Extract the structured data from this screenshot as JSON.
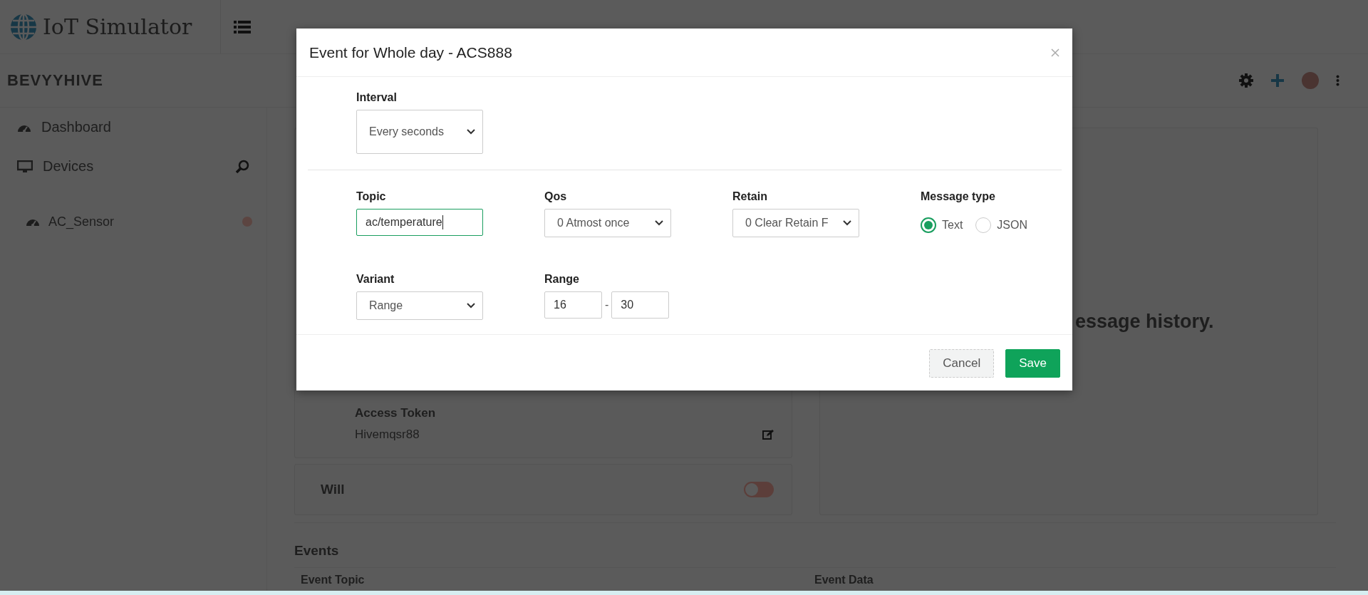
{
  "app": {
    "logo": "IoT Simulator"
  },
  "header": {
    "workspace": "BEVYYHIVE"
  },
  "sidebar": {
    "items": [
      {
        "label": "Dashboard",
        "kind": "dashboard"
      },
      {
        "label": "Devices",
        "kind": "devices"
      }
    ],
    "devices": [
      {
        "name": "AC_Sensor"
      }
    ]
  },
  "background": {
    "access_token_label": "Access Token",
    "access_token": "Hivemqsr88",
    "will": {
      "label": "Will",
      "on": false
    },
    "history_text": "essage history.",
    "events": {
      "title": "Events",
      "columns": [
        "Event Topic",
        "Event Data"
      ]
    }
  },
  "modal": {
    "title": "Event for Whole day - ACS888",
    "interval": {
      "label": "Interval",
      "value": "Every seconds"
    },
    "topic": {
      "label": "Topic",
      "value": "ac/temperature"
    },
    "qos": {
      "label": "Qos",
      "value": "0 Atmost once"
    },
    "retain": {
      "label": "Retain",
      "value": "0 Clear Retain F"
    },
    "message_type": {
      "label": "Message type",
      "options": [
        {
          "label": "Text",
          "selected": true
        },
        {
          "label": "JSON",
          "selected": false
        }
      ]
    },
    "variant": {
      "label": "Variant",
      "value": "Range"
    },
    "range": {
      "label": "Range",
      "min": "16",
      "separator": "-",
      "max": "30"
    },
    "buttons": [
      {
        "label": "Cancel",
        "kind": "secondary"
      },
      {
        "label": "Save",
        "kind": "primary"
      }
    ]
  }
}
